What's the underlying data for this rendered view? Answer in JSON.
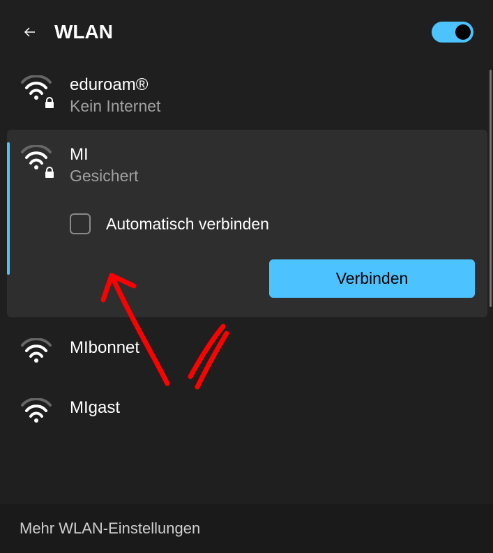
{
  "header": {
    "title": "WLAN",
    "wifi_enabled": true
  },
  "networks": [
    {
      "name": "eduroam®",
      "subtitle": "Kein Internet",
      "secured": true,
      "selected": false
    },
    {
      "name": "MI",
      "subtitle": "Gesichert",
      "secured": true,
      "selected": true,
      "auto_connect_label": "Automatisch verbinden",
      "auto_connect_checked": false,
      "connect_label": "Verbinden"
    },
    {
      "name": "MIbonnet",
      "subtitle": "",
      "secured": false,
      "selected": false
    },
    {
      "name": "MIgast",
      "subtitle": "",
      "secured": false,
      "selected": false
    }
  ],
  "footer": {
    "more_settings_label": "Mehr WLAN-Einstellungen"
  },
  "colors": {
    "accent": "#4cc2ff",
    "annotation": "#ff0000"
  }
}
